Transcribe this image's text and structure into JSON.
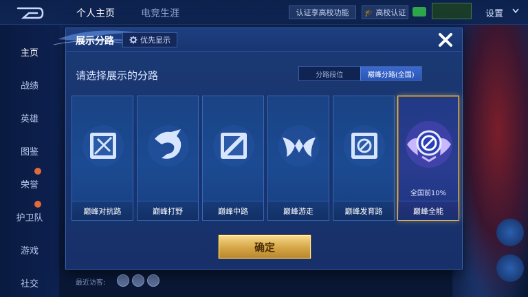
{
  "topbar": {
    "tabs": [
      "个人主页",
      "电竞生涯"
    ],
    "campus_promo": "认证享高校功能",
    "campus_verify": "高校认证",
    "promo_mini": [
      "",
      ""
    ],
    "settings": "设置"
  },
  "sidebar": {
    "items": [
      "主页",
      "战绩",
      "英雄",
      "图鉴",
      "荣誉",
      "护卫队",
      "游戏",
      "社交"
    ]
  },
  "footer": {
    "visitors": "最近访客:"
  },
  "modal": {
    "title": "展示分路",
    "priority_label": "优先显示",
    "prompt": "请选择展示的分路",
    "toggle": [
      "分路段位",
      "巅峰分路(全国)"
    ],
    "lanes": [
      {
        "label": "巅峰对抗路",
        "icon": "clash-lane-icon"
      },
      {
        "label": "巅峰打野",
        "icon": "jungle-icon"
      },
      {
        "label": "巅峰中路",
        "icon": "mid-lane-icon"
      },
      {
        "label": "巅峰游走",
        "icon": "roam-icon"
      },
      {
        "label": "巅峰发育路",
        "icon": "farm-lane-icon"
      },
      {
        "label": "巅峰全能",
        "icon": "all-round-emblem-icon",
        "rank": "全国前10%",
        "selected": true
      }
    ],
    "confirm": "确定"
  },
  "colors": {
    "accent_gold": "#f1c86a",
    "panel_blue": "#1b3974",
    "card_blue": "#1b4a92"
  }
}
